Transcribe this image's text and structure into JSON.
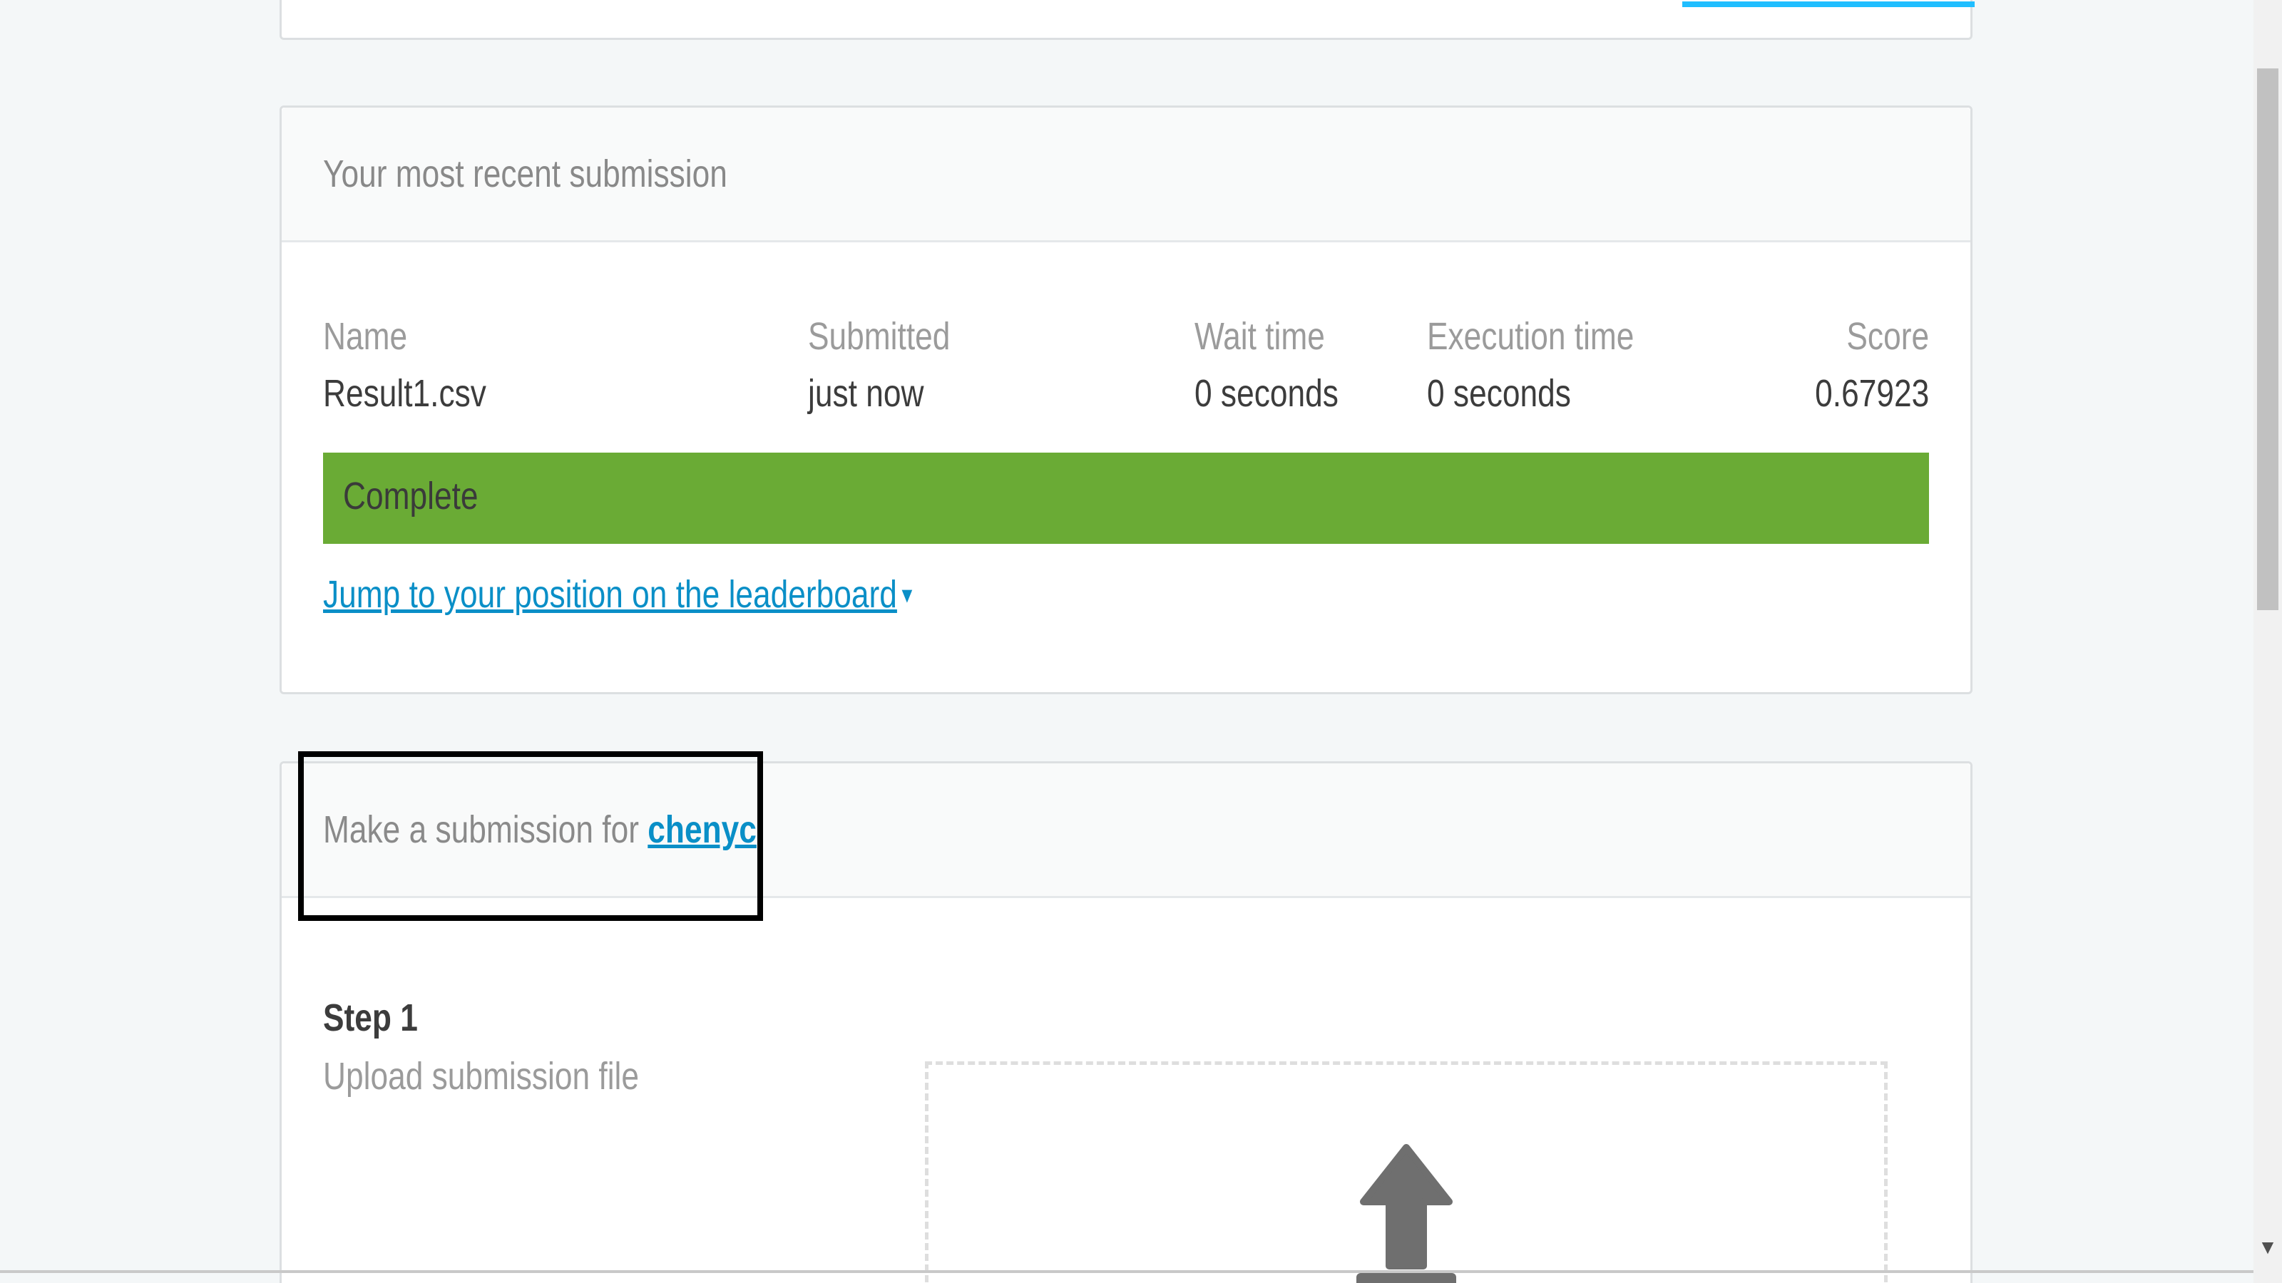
{
  "recent_submission": {
    "title": "Your most recent submission",
    "columns": {
      "name": "Name",
      "submitted": "Submitted",
      "wait_time": "Wait time",
      "execution_time": "Execution time",
      "score": "Score"
    },
    "row": {
      "name": "Result1.csv",
      "submitted": "just now",
      "wait_time": "0 seconds",
      "execution_time": "0 seconds",
      "score": "0.67923"
    },
    "status": "Complete",
    "leaderboard_link": "Jump to your position on the leaderboard",
    "caret": "▾"
  },
  "make_submission": {
    "title_prefix": "Make a submission for",
    "user": "chenyc",
    "step_label": "Step 1",
    "step_description": "Upload submission file"
  },
  "scrollbar": {
    "down_arrow": "▼"
  },
  "colors": {
    "accent": "#20beff",
    "link": "#0a8fc7",
    "status_complete": "#6aab35",
    "highlight_box": "#000000"
  },
  "icons": {
    "upload": "upload-arrow-icon",
    "caret": "caret-down-icon"
  }
}
